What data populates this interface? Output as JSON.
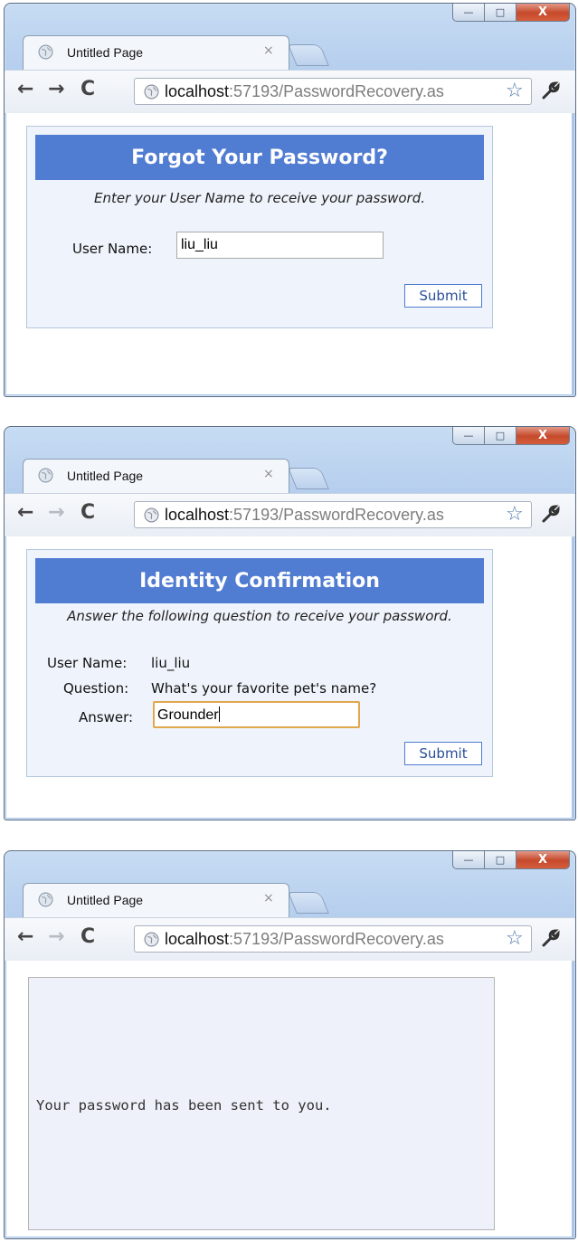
{
  "browser": {
    "tab_title": "Untitled Page",
    "tab_close": "×",
    "url_host": "localhost",
    "url_rest": ":57193/PasswordRecovery.as",
    "window_buttons": {
      "minimize": "—",
      "maximize": "□",
      "close": "X"
    }
  },
  "screens": [
    {
      "title": "Forgot Your Password?",
      "instruction": "Enter your User Name to receive your password.",
      "username_label": "User Name:",
      "username_value": "liu_liu",
      "submit_label": "Submit"
    },
    {
      "title": "Identity Confirmation",
      "instruction": "Answer the following question to receive your password.",
      "username_label": "User Name:",
      "username_value": "liu_liu",
      "question_label": "Question:",
      "question_value": "What's your favorite pet's name?",
      "answer_label": "Answer:",
      "answer_value": "Grounder",
      "submit_label": "Submit"
    },
    {
      "success_message": "Your password has been sent to you."
    }
  ],
  "colors": {
    "title_bar": "#507cd1",
    "panel_bg": "#eff3fb",
    "submit_text": "#284e98",
    "focus_border": "#e0a84d"
  }
}
